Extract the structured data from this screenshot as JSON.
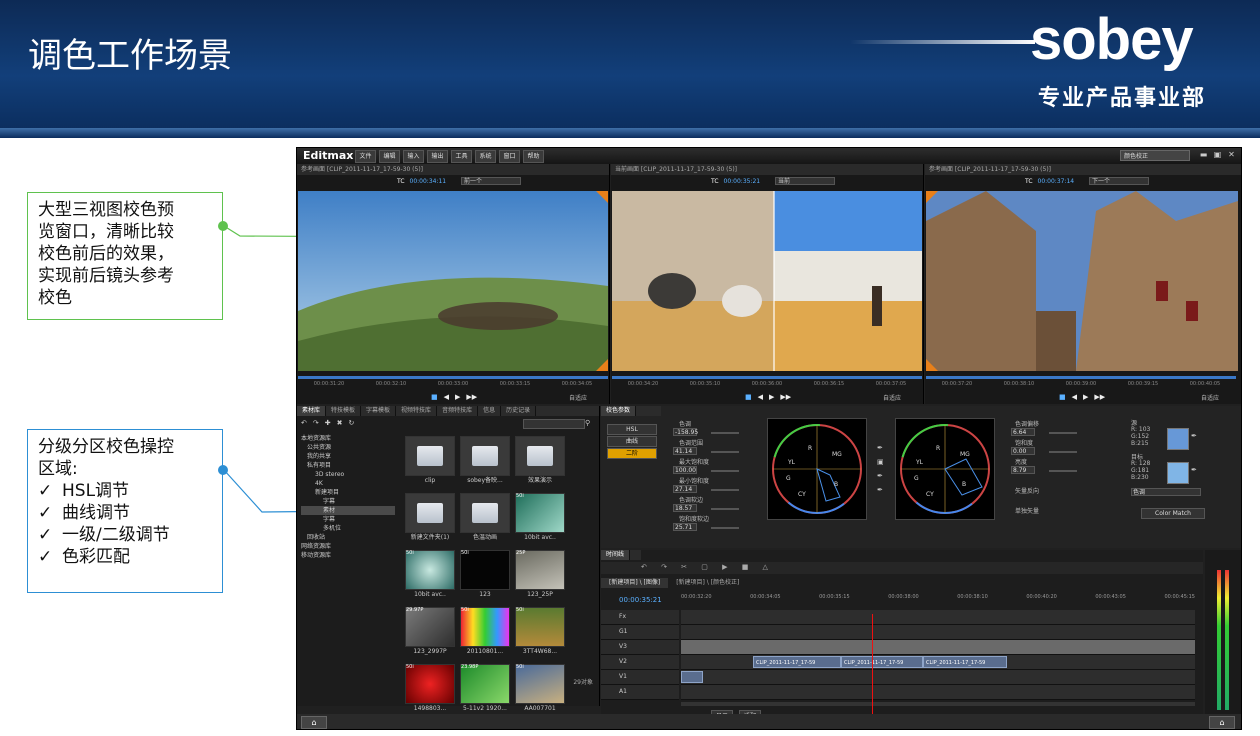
{
  "slide": {
    "title": "调色工作场景"
  },
  "logo": {
    "brand": "sobey",
    "subtitle": "专业产品事业部"
  },
  "callouts": {
    "preview": {
      "lines": [
        "大型三视图校色预",
        "览窗口，清晰比较",
        "校色前后的效果，",
        "实现前后镜头参考",
        "校色"
      ],
      "color": "#5fc24e"
    },
    "grading": {
      "lines": [
        "分级分区校色操控",
        "区域:"
      ],
      "items": [
        "HSL调节",
        "曲线调节",
        "一级/二级调节",
        "色彩匹配"
      ],
      "color": "#2d8fd4"
    }
  },
  "app": {
    "name": "Editmax",
    "menu": [
      "文件",
      "编辑",
      "输入",
      "输出",
      "工具",
      "系统",
      "窗口",
      "帮助"
    ],
    "preset": "颜色校正",
    "viewers": [
      {
        "header": "参考画面 [CLIP_2011-11-17_17-59-30 (5)]",
        "tc_label": "TC",
        "tc": "00:00:34:11",
        "select": "前一个",
        "ticks": [
          "00:00:31:20",
          "00:00:32:10",
          "00:00:33:00",
          "00:00:33:15",
          "00:00:34:05"
        ],
        "fit": "自适应"
      },
      {
        "header": "当前画面 [CLIP_2011-11-17_17-59-30 (5)]",
        "tc_label": "TC",
        "tc": "00:00:35:21",
        "select": "当前",
        "ticks": [
          "00:00:34:20",
          "00:00:35:10",
          "00:00:36:00",
          "00:00:36:15",
          "00:00:37:05"
        ],
        "fit": "自适应"
      },
      {
        "header": "参考画面 [CLIP_2011-11-17_17-59-30 (5)]",
        "tc_label": "TC",
        "tc": "00:00:37:14",
        "select": "下一个",
        "ticks": [
          "00:00:37:20",
          "00:00:38:10",
          "00:00:39:00",
          "00:00:39:15",
          "00:00:40:05"
        ],
        "fit": "自适应"
      }
    ],
    "library": {
      "tabs": [
        "素材库",
        "特技模板",
        "字幕模板",
        "视频特技库",
        "音频特技库",
        "信息",
        "历史记录"
      ],
      "tree": [
        "本地资源库",
        "公共资源",
        "我的共享",
        "私有项目",
        "3D stereo",
        "4K",
        "新建项目",
        "字幕",
        "素材",
        "字幕",
        "多机位",
        "回收站",
        "网络资源库",
        "移动资源库"
      ],
      "items": [
        {
          "name": "clip",
          "badge": ""
        },
        {
          "name": "sobey备映...",
          "badge": ""
        },
        {
          "name": "效果演示",
          "badge": ""
        },
        {
          "name": "新建文件夹(1)",
          "badge": ""
        },
        {
          "name": "色温动画",
          "badge": ""
        },
        {
          "name": "10bit avc..",
          "badge": "50i"
        },
        {
          "name": "10bit avc..",
          "badge": "50i"
        },
        {
          "name": "123",
          "badge": "50i"
        },
        {
          "name": "123_25P",
          "badge": "25P"
        },
        {
          "name": "123_2997P",
          "badge": "29.97P"
        },
        {
          "name": "20110801...",
          "badge": "50i"
        },
        {
          "name": "3TT4W68...",
          "badge": "50i"
        },
        {
          "name": "1498803...",
          "badge": "50i"
        },
        {
          "name": "5-11v2 1920...",
          "badge": "23.98P"
        },
        {
          "name": "AA007701",
          "badge": "50i"
        }
      ],
      "count": "29对象"
    },
    "grading": {
      "tab": "校色参数",
      "modes": [
        "HSL",
        "曲线",
        "二阶"
      ],
      "params_left": [
        {
          "label": "色调",
          "value": "-158.95"
        },
        {
          "label": "色调范围",
          "value": "41.14"
        },
        {
          "label": "最大饱和度",
          "value": "100.00"
        },
        {
          "label": "最小饱和度",
          "value": "27.14"
        },
        {
          "label": "色调软边",
          "value": "18.57"
        },
        {
          "label": "饱和度软边",
          "value": "25.71"
        }
      ],
      "params_right": [
        {
          "label": "色调偏移",
          "value": "6.64"
        },
        {
          "label": "饱和度",
          "value": "0.00"
        },
        {
          "label": "亮度",
          "value": "8.79"
        }
      ],
      "options": [
        "矢量反向",
        "单独矢量"
      ],
      "source": {
        "label": "源",
        "r": "R: 103",
        "g": "G:152",
        "b": "B:215",
        "color": "#6798d7"
      },
      "target": {
        "label": "目标",
        "r": "R: 128",
        "g": "G:181",
        "b": "B:230",
        "color": "#80b5e6"
      },
      "match_mode": "色调",
      "match_button": "Color Match",
      "wheel_labels": [
        "R",
        "MG",
        "B",
        "CY",
        "G",
        "YL"
      ]
    },
    "timeline": {
      "tab": "时间线",
      "seq_tabs": [
        "[新建项目] \\ [图像]",
        "[新建项目] \\ [颜色校正]"
      ],
      "tc": "00:00:35:21",
      "ruler": [
        "00:00:32:20",
        "00:00:34:05",
        "00:00:35:15",
        "00:00:38:00",
        "00:00:38:10",
        "00:00:40:20",
        "00:00:43:05",
        "00:00:45:15"
      ],
      "tracks": [
        "Fx",
        "G1",
        "V3",
        "V2",
        "V1",
        "A1"
      ],
      "clips": [
        "CLIP_2011-11-17_17-59",
        "CLIP_2011-11-17_17-59",
        "CLIP_2011-11-17_17-59"
      ],
      "buttons": [
        "显示",
        "适配"
      ]
    }
  }
}
